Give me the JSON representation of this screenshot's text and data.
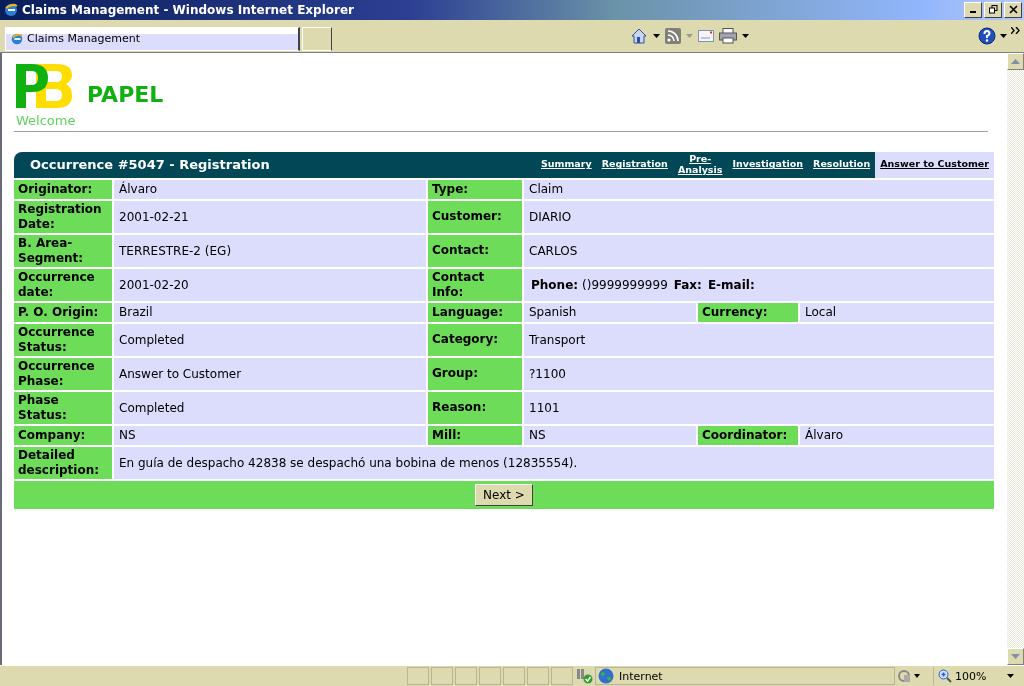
{
  "window": {
    "title": "Claims Management - Windows Internet Explorer"
  },
  "browser_tab": {
    "title": "Claims Management"
  },
  "header": {
    "brand": "PAPEL",
    "welcome": "Welcome"
  },
  "panel": {
    "title": "Occurrence #5047 - Registration",
    "tabs": [
      {
        "label": "Summary",
        "selected": false
      },
      {
        "label": "Registration",
        "selected": false
      },
      {
        "label": "Pre-\nAnalysis",
        "selected": false
      },
      {
        "label": "Investigation",
        "selected": false
      },
      {
        "label": "Resolution",
        "selected": false
      },
      {
        "label": "Answer to Customer",
        "selected": true
      }
    ],
    "rows": [
      {
        "fields": [
          {
            "label": "Originator:",
            "value": "Álvaro"
          },
          {
            "label": "Type:",
            "value": "Claim"
          }
        ]
      },
      {
        "fields": [
          {
            "label": "Registration Date:",
            "value": "2001-02-21"
          },
          {
            "label": "Customer:",
            "value": "DIARIO"
          }
        ]
      },
      {
        "fields": [
          {
            "label": "B. Area-Segment:",
            "value": "TERRESTRE-2 (EG)"
          },
          {
            "label": "Contact:",
            "value": "CARLOS"
          }
        ]
      },
      {
        "fields": [
          {
            "label": "Occurrence date:",
            "value": "2001-02-20"
          },
          {
            "label": "Contact Info:",
            "parts": [
              {
                "label": "Phone:",
                "value": "()9999999999"
              },
              {
                "label": "Fax:"
              },
              {
                "label": "E-mail:"
              }
            ]
          }
        ]
      },
      {
        "fields": [
          {
            "label": "P. O. Origin:",
            "value": "Brazil"
          },
          {
            "label": "Language:",
            "value": "Spanish"
          },
          {
            "label": "Currency:",
            "value": "Local"
          }
        ]
      },
      {
        "fields": [
          {
            "label": "Occurrence Status:",
            "value": "Completed"
          },
          {
            "label": "Category:",
            "value": "Transport"
          }
        ]
      },
      {
        "fields": [
          {
            "label": "Occurrence Phase:",
            "value": "Answer to Customer"
          },
          {
            "label": "Group:",
            "value": "?1100"
          }
        ]
      },
      {
        "fields": [
          {
            "label": "Phase Status:",
            "value": "Completed"
          },
          {
            "label": "Reason:",
            "value": "1101"
          }
        ]
      },
      {
        "fields": [
          {
            "label": "Company:",
            "value": "NS"
          },
          {
            "label": "Mill:",
            "value": "NS"
          },
          {
            "label": "Coordinator:",
            "value": "Álvaro"
          }
        ]
      },
      {
        "fields": [
          {
            "label": "Detailed description:",
            "value": "En guía de despacho 42838 se despachó una bobina de menos (12835554)."
          }
        ]
      }
    ],
    "next_button": "Next >"
  },
  "status_bar": {
    "zone": "Internet",
    "zoom": "100%"
  }
}
